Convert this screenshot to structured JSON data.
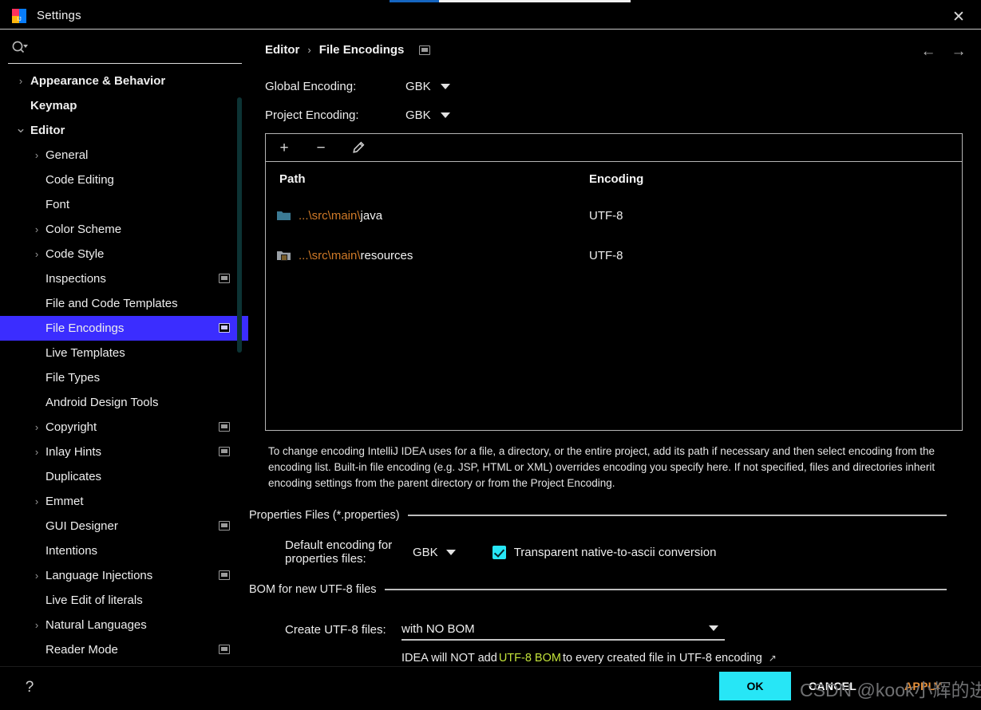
{
  "window": {
    "title": "Settings",
    "app_icon": "intellij-idea-icon",
    "close_icon": "close-icon"
  },
  "progress": {
    "visible": true,
    "fill_percent": 21,
    "fill_color": "#1565c0",
    "track_color": "#f2f2f2"
  },
  "sidebar": {
    "search": {
      "placeholder": "",
      "value": "",
      "icon": "search-icon"
    },
    "items": [
      {
        "label": "Appearance & Behavior",
        "level": 0,
        "arrow": "chevron-right",
        "badge": false,
        "selected": false
      },
      {
        "label": "Keymap",
        "level": 0,
        "arrow": "",
        "badge": false,
        "selected": false
      },
      {
        "label": "Editor",
        "level": 0,
        "arrow": "chevron-down",
        "badge": false,
        "selected": false
      },
      {
        "label": "General",
        "level": 1,
        "arrow": "chevron-right",
        "badge": false,
        "selected": false
      },
      {
        "label": "Code Editing",
        "level": 1,
        "arrow": "",
        "badge": false,
        "selected": false
      },
      {
        "label": "Font",
        "level": 1,
        "arrow": "",
        "badge": false,
        "selected": false
      },
      {
        "label": "Color Scheme",
        "level": 1,
        "arrow": "chevron-right",
        "badge": false,
        "selected": false
      },
      {
        "label": "Code Style",
        "level": 1,
        "arrow": "chevron-right",
        "badge": false,
        "selected": false
      },
      {
        "label": "Inspections",
        "level": 1,
        "arrow": "",
        "badge": true,
        "selected": false
      },
      {
        "label": "File and Code Templates",
        "level": 1,
        "arrow": "",
        "badge": false,
        "selected": false
      },
      {
        "label": "File Encodings",
        "level": 1,
        "arrow": "",
        "badge": true,
        "selected": true
      },
      {
        "label": "Live Templates",
        "level": 1,
        "arrow": "",
        "badge": false,
        "selected": false
      },
      {
        "label": "File Types",
        "level": 1,
        "arrow": "",
        "badge": false,
        "selected": false
      },
      {
        "label": "Android Design Tools",
        "level": 1,
        "arrow": "",
        "badge": false,
        "selected": false
      },
      {
        "label": "Copyright",
        "level": 1,
        "arrow": "chevron-right",
        "badge": true,
        "selected": false
      },
      {
        "label": "Inlay Hints",
        "level": 1,
        "arrow": "chevron-right",
        "badge": true,
        "selected": false
      },
      {
        "label": "Duplicates",
        "level": 1,
        "arrow": "",
        "badge": false,
        "selected": false
      },
      {
        "label": "Emmet",
        "level": 1,
        "arrow": "chevron-right",
        "badge": false,
        "selected": false
      },
      {
        "label": "GUI Designer",
        "level": 1,
        "arrow": "",
        "badge": true,
        "selected": false
      },
      {
        "label": "Intentions",
        "level": 1,
        "arrow": "",
        "badge": false,
        "selected": false
      },
      {
        "label": "Language Injections",
        "level": 1,
        "arrow": "chevron-right",
        "badge": true,
        "selected": false
      },
      {
        "label": "Live Edit of literals",
        "level": 1,
        "arrow": "",
        "badge": false,
        "selected": false
      },
      {
        "label": "Natural Languages",
        "level": 1,
        "arrow": "chevron-right",
        "badge": false,
        "selected": false
      },
      {
        "label": "Reader Mode",
        "level": 1,
        "arrow": "",
        "badge": true,
        "selected": false
      }
    ],
    "selected_color": "#3b2dff",
    "scrollbar_color": "#0c3334"
  },
  "content": {
    "breadcrumb": {
      "parent": "Editor",
      "separator": "›",
      "current": "File Encodings",
      "badge": "project-scope-icon"
    },
    "nav": {
      "back_icon": "arrow-left-icon",
      "forward_icon": "arrow-right-icon"
    },
    "global_encoding": {
      "label": "Global Encoding:",
      "value": "GBK"
    },
    "project_encoding": {
      "label": "Project Encoding:",
      "value": "GBK"
    },
    "toolbar": {
      "add": "+",
      "remove": "−",
      "edit": "pencil-icon"
    },
    "table": {
      "columns": [
        "Path",
        "Encoding"
      ],
      "rows": [
        {
          "icon": "folder-icon",
          "path_prefix": "...\\src\\main\\",
          "path_last": "java",
          "encoding": "UTF-8"
        },
        {
          "icon": "resources-folder-icon",
          "path_prefix": "...\\src\\main\\",
          "path_last": "resources",
          "encoding": "UTF-8"
        }
      ]
    },
    "description": "To change encoding IntelliJ IDEA uses for a file, a directory, or the entire project, add its path if necessary and then select encoding from the encoding list. Built-in file encoding (e.g. JSP, HTML or XML) overrides encoding you specify here. If not specified, files and directories inherit encoding settings from the parent directory or from the Project Encoding.",
    "properties_group": {
      "title": "Properties Files (*.properties)",
      "default_encoding_label": "Default encoding for properties files:",
      "default_encoding_value": "GBK",
      "checkbox_label": "Transparent native-to-ascii conversion",
      "checkbox_checked": true,
      "checkbox_color": "#27e6f6"
    },
    "bom_group": {
      "title": "BOM for new UTF-8 files",
      "create_label": "Create UTF-8 files:",
      "create_value": "with NO BOM",
      "hint_before": "IDEA will NOT add ",
      "hint_highlight": "UTF-8 BOM",
      "hint_after": " to every created file in UTF-8 encoding",
      "hint_highlight_color": "#c2e23a",
      "external_link_icon": "external-link-icon"
    }
  },
  "footer": {
    "help_label": "?",
    "ok_label": "OK",
    "cancel_label": "CANCEL",
    "apply_label": "APPLY",
    "ok_color": "#27e6f6",
    "apply_color": "#e8913a"
  },
  "watermark": {
    "text": "CSDN @kook小辉的进阶"
  }
}
